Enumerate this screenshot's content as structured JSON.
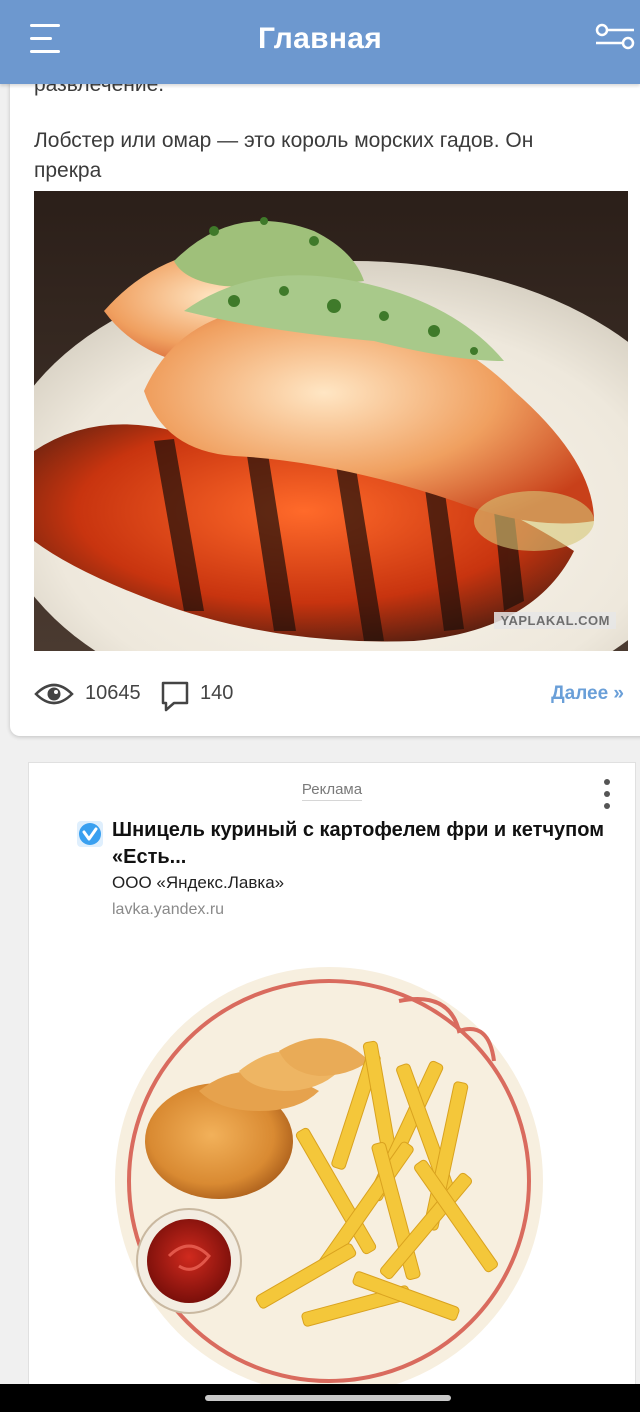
{
  "header": {
    "title": "Главная",
    "menu_icon": "hamburger-menu-icon",
    "filter_icon": "filter-sliders-icon",
    "bg_color": "#6d98cf"
  },
  "post": {
    "text_cut": "развлечение.",
    "text": "Лобстер или омар — это король морских гадов. Он прекра",
    "image_watermark": "YAPLAKAL.COM",
    "views": "10645",
    "comments": "140",
    "more_link": "Далее »",
    "link_color": "#6a9fd8"
  },
  "ad": {
    "label": "Реклама",
    "title": "Шницель куриный с картофелем фри и кетчупом «Есть...",
    "company": "ООО «Яндекс.Лавка»",
    "domain": "lavka.yandex.ru"
  }
}
